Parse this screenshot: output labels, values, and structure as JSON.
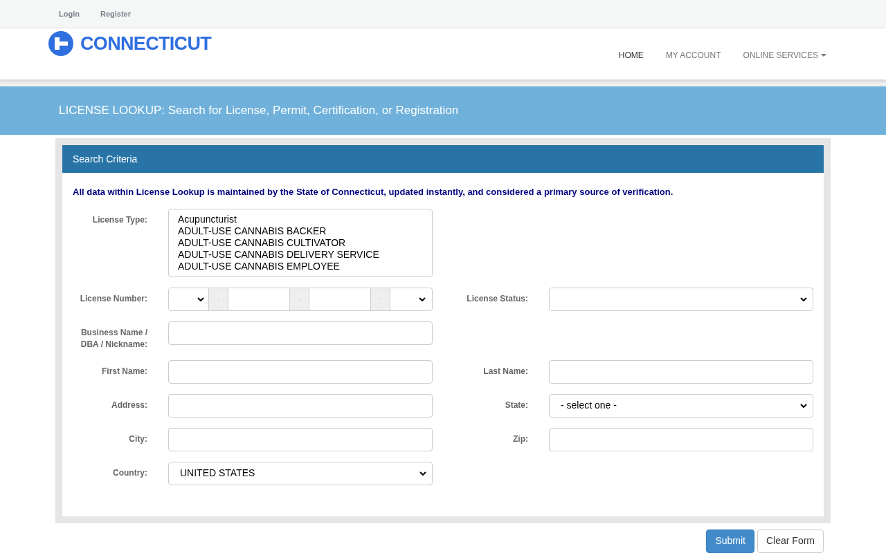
{
  "top_links": [
    "Login",
    "Register"
  ],
  "logo": {
    "text": "CONNECTICUT"
  },
  "nav": [
    {
      "label": "HOME",
      "selected": true,
      "dropdown": false
    },
    {
      "label": "MY ACCOUNT",
      "selected": false,
      "dropdown": false
    },
    {
      "label": "ONLINE SERVICES",
      "selected": false,
      "dropdown": true
    }
  ],
  "banner": {
    "title": "LICENSE LOOKUP: Search for License, Permit, Certification, or Registration"
  },
  "panel": {
    "title": "Search Criteria",
    "notice": "All data within License Lookup is maintained by the State of Connecticut, updated instantly, and considered a primary source of verification."
  },
  "rows": [
    {
      "left": {
        "kind": "listbox",
        "label": "License Type:",
        "options": [
          "Acupuncturist",
          "ADULT-USE CANNABIS BACKER",
          "ADULT-USE CANNABIS CULTIVATOR",
          "ADULT-USE CANNABIS DELIVERY SERVICE",
          "ADULT-USE CANNABIS EMPLOYEE"
        ]
      }
    },
    {
      "left": {
        "kind": "license_number",
        "label": "License Number:",
        "separators": [
          ".",
          ".",
          "-"
        ]
      },
      "right": {
        "kind": "select",
        "label": "License Status:"
      }
    },
    {
      "left": {
        "kind": "text",
        "label": "Business Name / DBA / Nickname:"
      }
    },
    {
      "left": {
        "kind": "text",
        "label": "First Name:"
      },
      "right": {
        "kind": "text",
        "label": "Last Name:"
      }
    },
    {
      "left": {
        "kind": "text",
        "label": "Address:"
      },
      "right": {
        "kind": "select",
        "label": "State:",
        "value": "- select one -"
      }
    },
    {
      "left": {
        "kind": "text",
        "label": "City:"
      },
      "right": {
        "kind": "text",
        "label": "Zip:"
      }
    },
    {
      "left": {
        "kind": "select",
        "label": "Country:",
        "value": "UNITED STATES"
      }
    }
  ],
  "buttons": [
    {
      "label": "Submit",
      "kind": "primary"
    },
    {
      "label": "Clear Form",
      "kind": "default"
    }
  ]
}
